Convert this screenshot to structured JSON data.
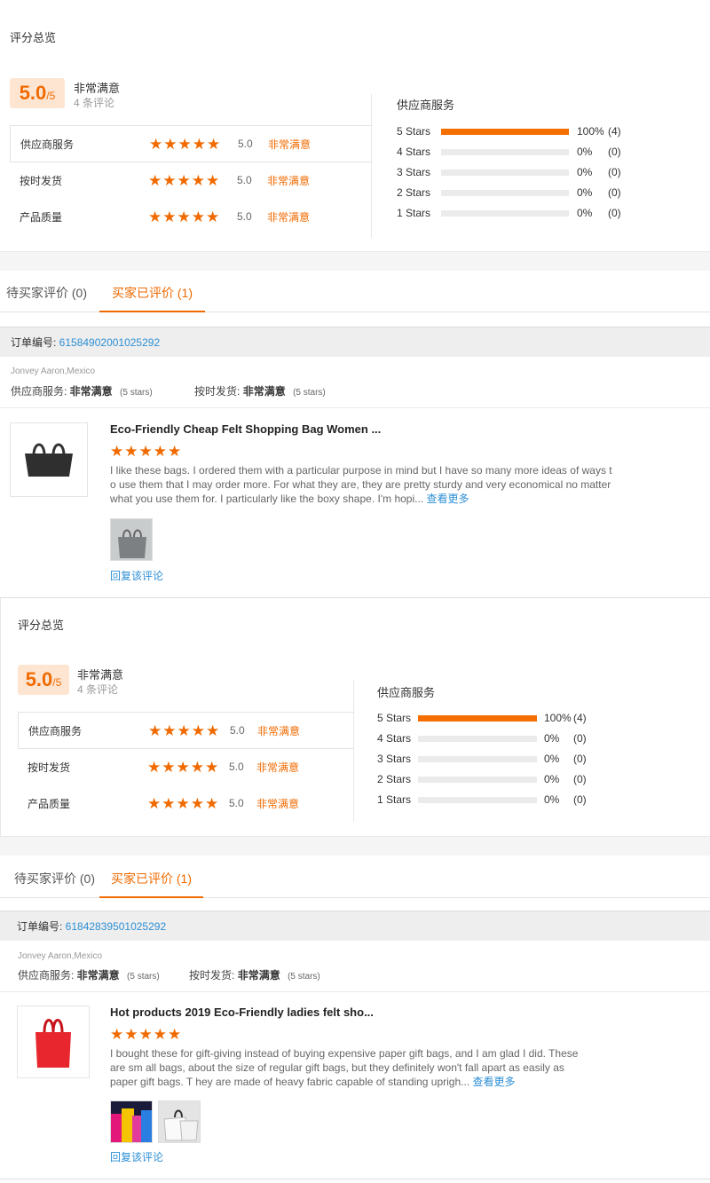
{
  "summary": {
    "title": "评分总览",
    "score": "5.0",
    "score_suffix": "/5",
    "verdict": "非常满意",
    "review_count": "4 条评论",
    "ratings": [
      {
        "label": "供应商服务",
        "value": "5.0",
        "word": "非常满意",
        "stars": 5
      },
      {
        "label": "按时发货",
        "value": "5.0",
        "word": "非常满意",
        "stars": 5
      },
      {
        "label": "产品质量",
        "value": "5.0",
        "word": "非常满意",
        "stars": 5
      }
    ],
    "distribution_title": "供应商服务",
    "distribution": [
      {
        "label": "5 Stars",
        "fraction": 1.0,
        "pct": "100%",
        "count": "(4)"
      },
      {
        "label": "4 Stars",
        "fraction": 0,
        "pct": "0%",
        "count": "(0)"
      },
      {
        "label": "3 Stars",
        "fraction": 0,
        "pct": "0%",
        "count": "(0)"
      },
      {
        "label": "2 Stars",
        "fraction": 0,
        "pct": "0%",
        "count": "(0)"
      },
      {
        "label": "1 Stars",
        "fraction": 0,
        "pct": "0%",
        "count": "(0)"
      }
    ]
  },
  "tabs": [
    {
      "label": "待买家评价 (0)",
      "active": false
    },
    {
      "label": "买家已评价 (1)",
      "active": true
    }
  ],
  "reviews": [
    {
      "order_label": "订单编号: ",
      "order_no": "61584902001025292",
      "buyer": "Jonvey Aaron,Mexico",
      "supplier_label": "供应商服务: ",
      "supplier_value": "非常满意",
      "supplier_stars": "(5 stars)",
      "shipping_label": "按时发货: ",
      "shipping_value": "非常满意",
      "shipping_stars": "(5 stars)",
      "product_title": "Eco-Friendly Cheap Felt Shopping Bag Women ...",
      "stars": 5,
      "text": "I like these bags. I ordered them with a particular purpose in mind but I have so many more ideas of ways t o use them that I may order more. For what they are, they are pretty sturdy and very economical no matter what you use them for. I particularly like the boxy shape. I'm hopi...",
      "more": "查看更多",
      "reply": "回复该评论"
    },
    {
      "order_label": "订单编号: ",
      "order_no": "61842839501025292",
      "buyer": "Jonvey Aaron,Mexico",
      "supplier_label": "供应商服务: ",
      "supplier_value": "非常满意",
      "supplier_stars": "(5 stars)",
      "shipping_label": "按时发货: ",
      "shipping_value": "非常满意",
      "shipping_stars": "(5 stars)",
      "product_title": "Hot products 2019 Eco-Friendly ladies felt sho...",
      "stars": 5,
      "text": "I bought these for gift-giving instead of buying expensive paper gift bags, and I am glad I did. These are sm all bags, about the size of regular gift bags, but they definitely won't fall apart as easily as paper gift bags. T hey are made of heavy fabric capable of standing uprigh...",
      "more": "查看更多",
      "reply": "回复该评论"
    }
  ],
  "colors": {
    "accent": "#f06a00",
    "link": "#2d8fd5",
    "score_bg": "#fde5d2"
  }
}
